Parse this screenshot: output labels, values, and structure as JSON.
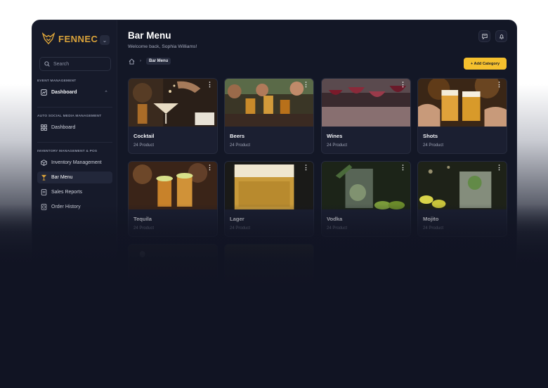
{
  "app": {
    "brand": "FENNEC"
  },
  "sidebar": {
    "search_placeholder": "Search",
    "sections": [
      {
        "title": "EVENT MANAGEMENT"
      },
      {
        "title": "AUTO SOCIAL MEDIA MANAGEMENT"
      },
      {
        "title": "INVENTORY MANAGEMENT & POS"
      }
    ],
    "items": [
      {
        "label": "Dashboard",
        "icon": "chart-icon"
      },
      {
        "label": "Dashboard",
        "icon": "grid-icon"
      },
      {
        "label": "Inventory Management",
        "icon": "box-icon"
      },
      {
        "label": "Bar Menu",
        "icon": "cocktail-icon",
        "active": true
      },
      {
        "label": "Sales Reports",
        "icon": "report-icon"
      },
      {
        "label": "Order History",
        "icon": "history-icon"
      }
    ]
  },
  "header": {
    "title": "Bar Menu",
    "subtitle": "Welcome back, Sophia Williams!",
    "breadcrumb_current": "Bar Menu",
    "add_button": "+ Add Category"
  },
  "categories": [
    {
      "name": "Cocktail",
      "count": "24 Product"
    },
    {
      "name": "Beers",
      "count": "24 Product"
    },
    {
      "name": "Wines",
      "count": "24 Product"
    },
    {
      "name": "Shots",
      "count": "24 Product"
    },
    {
      "name": "Tequila",
      "count": "24 Product"
    },
    {
      "name": "Lager",
      "count": "24 Product"
    },
    {
      "name": "Vodka",
      "count": "24 Product"
    },
    {
      "name": "Mojito",
      "count": "24 Product"
    }
  ],
  "colors": {
    "accent": "#f5c02e",
    "brand": "#d9a23a",
    "background": "#131726"
  }
}
